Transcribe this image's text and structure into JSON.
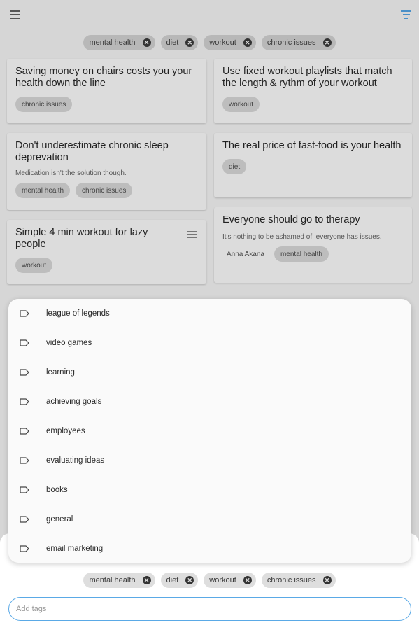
{
  "colors": {
    "accent": "#5aa9e6",
    "filter_icon": "#4a90c8",
    "chip_bg": "#b8b8b8"
  },
  "header": {
    "menu_icon": "hamburger-menu-icon",
    "filter_icon": "filter-icon"
  },
  "active_filters": [
    "mental health",
    "diet",
    "workout",
    "chronic issues"
  ],
  "cards": [
    {
      "title": "Saving money on chairs costs you your health down the line",
      "subtitle": "",
      "author": "",
      "tags": [
        "chronic issues"
      ]
    },
    {
      "title": "Use fixed workout playlists that match the length & rythm of your workout",
      "subtitle": "",
      "author": "",
      "tags": [
        "workout"
      ]
    },
    {
      "title": "Don't underestimate chronic sleep deprevation",
      "subtitle": "Medication isn't the solution though.",
      "author": "",
      "tags": [
        "mental health",
        "chronic issues"
      ]
    },
    {
      "title": "The real price of fast-food is your health",
      "subtitle": "",
      "author": "",
      "tags": [
        "diet"
      ]
    },
    {
      "title": "Simple 4 min workout for lazy people",
      "subtitle": "",
      "author": "",
      "tags": [
        "workout"
      ],
      "icon": "list-icon"
    },
    {
      "title": "Everyone should go to therapy",
      "subtitle": "It's nothing to be ashamed of, everyone has issues.",
      "author": "Anna Akana",
      "tags": [
        "mental health"
      ]
    }
  ],
  "tag_suggestions": {
    "icon": "label-tag-icon",
    "items": [
      "league of legends",
      "video games",
      "learning",
      "achieving goals",
      "employees",
      "evaluating ideas",
      "books",
      "general",
      "email marketing"
    ]
  },
  "selected_tags": [
    "mental health",
    "diet",
    "workout",
    "chronic issues"
  ],
  "tag_input": {
    "value": "",
    "placeholder": "Add tags"
  }
}
